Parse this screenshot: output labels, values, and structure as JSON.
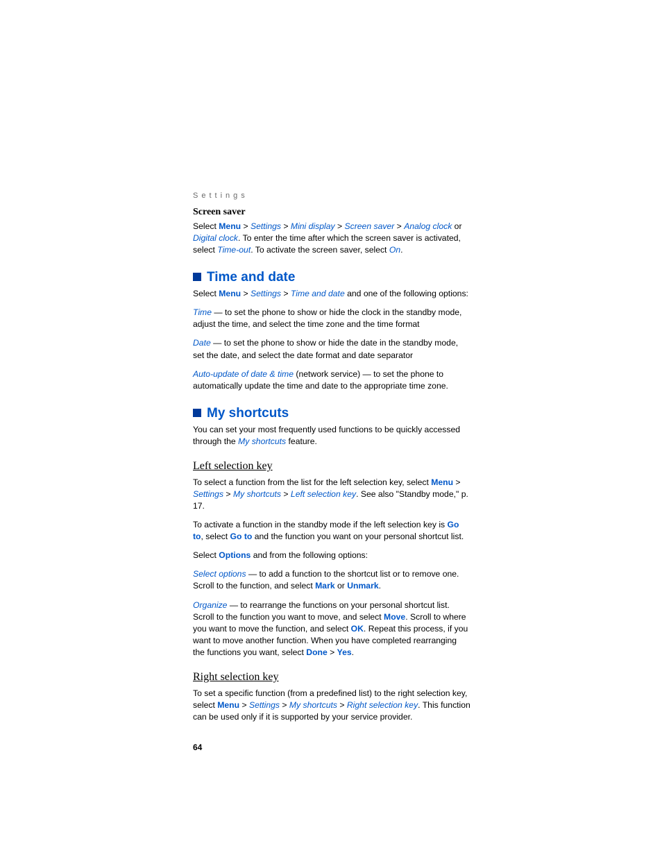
{
  "header": "Settings",
  "s1": {
    "title": "Screen saver",
    "p1_a": "Select ",
    "menu": "Menu",
    "gt": " > ",
    "settings": "Settings",
    "mini": "Mini display",
    "ss": "Screen saver",
    "analog": "Analog clock",
    "or": " or ",
    "digital": "Digital clock",
    "p1_b": ". To enter the time after which the screen saver is activated, select ",
    "timeout": "Time-out",
    "p1_c": ". To activate the screen saver, select ",
    "on": "On",
    "p1_d": "."
  },
  "s2": {
    "title": "Time and date",
    "p1_a": "Select ",
    "menu": "Menu",
    "settings": "Settings",
    "td": "Time and date",
    "p1_b": " and one of the following options:",
    "time": "Time",
    "time_b": " — to set the phone to show or hide the clock in the standby mode, adjust the time, and select the time zone and the time format",
    "date": "Date",
    "date_b": " — to set the phone to show or hide the date in the standby mode, set the date, and select the date format and date separator",
    "auto": "Auto-update of date & time",
    "auto_b": " (network service) — to set the phone to automatically update the time and date to the appropriate time zone."
  },
  "s3": {
    "title": "My shortcuts",
    "p1_a": "You can set your most frequently used functions to be quickly accessed through the ",
    "ms": "My shortcuts",
    "p1_b": " feature."
  },
  "s4": {
    "title": "Left selection key",
    "p1_a": "To select a function from the list for the left selection key, select ",
    "menu": "Menu",
    "settings": "Settings",
    "ms": "My shortcuts",
    "lsk": "Left selection key",
    "p1_b": ". See also \"Standby mode,\" p. 17.",
    "p2_a": "To activate a function in the standby mode if the left selection key is ",
    "goto": "Go to",
    "p2_b": ", select ",
    "p2_c": " and the function you want on your personal shortcut list.",
    "p3_a": "Select ",
    "options": "Options",
    "p3_b": " and from the following options:",
    "so": "Select options",
    "so_b": " — to add a function to the shortcut list or to remove one. Scroll to the function, and select ",
    "mark": "Mark",
    "or": " or ",
    "unmark": "Unmark",
    "so_c": ".",
    "org": "Organize",
    "org_b": " — to rearrange the functions on your personal shortcut list. Scroll to the function you want to move, and select ",
    "move": "Move",
    "org_c": ". Scroll to where you want to move the function, and select ",
    "ok": "OK",
    "org_d": ". Repeat this process, if you want to move another function. When you have completed rearranging the functions you want, select ",
    "done": "Done",
    "yes": "Yes",
    "org_e": "."
  },
  "s5": {
    "title": "Right selection key",
    "p1_a": "To set a specific function (from a predefined list) to the right selection key, select ",
    "menu": "Menu",
    "settings": "Settings",
    "ms": "My shortcuts",
    "rsk": "Right selection key",
    "p1_b": ". This function can be used only if it is supported by your service provider."
  },
  "pagenum": "64"
}
